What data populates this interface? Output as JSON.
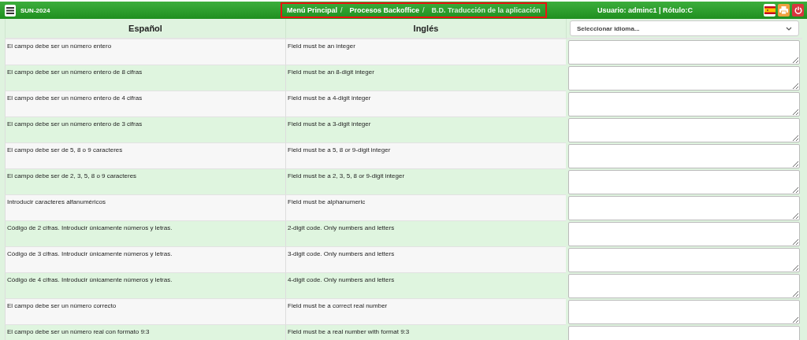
{
  "app": {
    "title": "SUN-2024"
  },
  "breadcrumb": [
    {
      "label": "Menú Principal",
      "current": false,
      "separator": "/"
    },
    {
      "label": "Procesos Backoffice",
      "current": false,
      "separator": "/"
    },
    {
      "label": "B.D. Traducción de la aplicación",
      "current": true
    }
  ],
  "user_info": "Usuario: adminc1 | Rótulo:C",
  "table": {
    "columns": [
      "Español",
      "Inglés"
    ],
    "language_select": {
      "value": "Seleccionar idioma..."
    },
    "rows": [
      {
        "es": "El campo debe ser un número entero",
        "en": "Field must be an integer"
      },
      {
        "es": "El campo debe ser un número entero de 8 cifras",
        "en": "Field must be an 8-digit integer"
      },
      {
        "es": "El campo debe ser un número entero de 4 cifras",
        "en": "Field must be a 4-digit integer"
      },
      {
        "es": "El campo debe ser un número entero de 3 cifras",
        "en": "Field must be a 3-digit integer"
      },
      {
        "es": "El campo debe ser de 5, 8 o 9 caracteres",
        "en": "Field must be a 5, 8 or 9-digit integer"
      },
      {
        "es": "El campo debe ser de 2, 3, 5, 8 o 9 caracteres",
        "en": "Field must be a 2, 3, 5, 8 or 9-digit integer"
      },
      {
        "es": "Introducir caracteres alfanuméricos",
        "en": "Field must be alphanumeric"
      },
      {
        "es": "Código de 2 cifras. Introducir únicamente números y letras.",
        "en": "2-digit code. Only numbers and letters"
      },
      {
        "es": "Código de 3 cifras. Introducir únicamente números y letras.",
        "en": "3-digit code. Only numbers and letters"
      },
      {
        "es": "Código de 4 cifras. Introducir únicamente números y letras.",
        "en": "4-digit code. Only numbers and letters"
      },
      {
        "es": "El campo debe ser un número correcto",
        "en": "Field must be a correct real number"
      },
      {
        "es": "El campo debe ser un número real con formato 9:3",
        "en": "Field must be a real number with format 9:3"
      }
    ]
  }
}
